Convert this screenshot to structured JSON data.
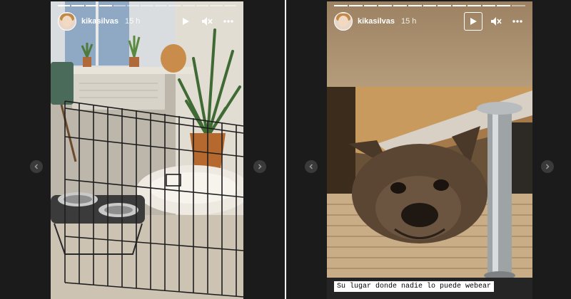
{
  "stories": [
    {
      "username": "kikasilvas",
      "time": "15 h",
      "progress": {
        "segments": 13,
        "completed": 4
      },
      "controls": {
        "play_icon": "play-icon",
        "sound_icon": "speaker-muted-icon",
        "more_icon": "more-icon"
      },
      "scene": "room with dog pen, plants and bowls",
      "caption": ""
    },
    {
      "username": "kikasilvas",
      "time": "15 h",
      "progress": {
        "segments": 13,
        "completed": 12
      },
      "controls": {
        "play_icon": "play-icon",
        "sound_icon": "speaker-muted-icon",
        "more_icon": "more-icon"
      },
      "scene": "french bulldog lying under furniture",
      "caption": "Su lugar donde nadie lo puede webear"
    }
  ],
  "colors": {
    "backdrop": "#1b1b1b",
    "text": "#ffffff",
    "caption_bg": "#ffffff"
  }
}
